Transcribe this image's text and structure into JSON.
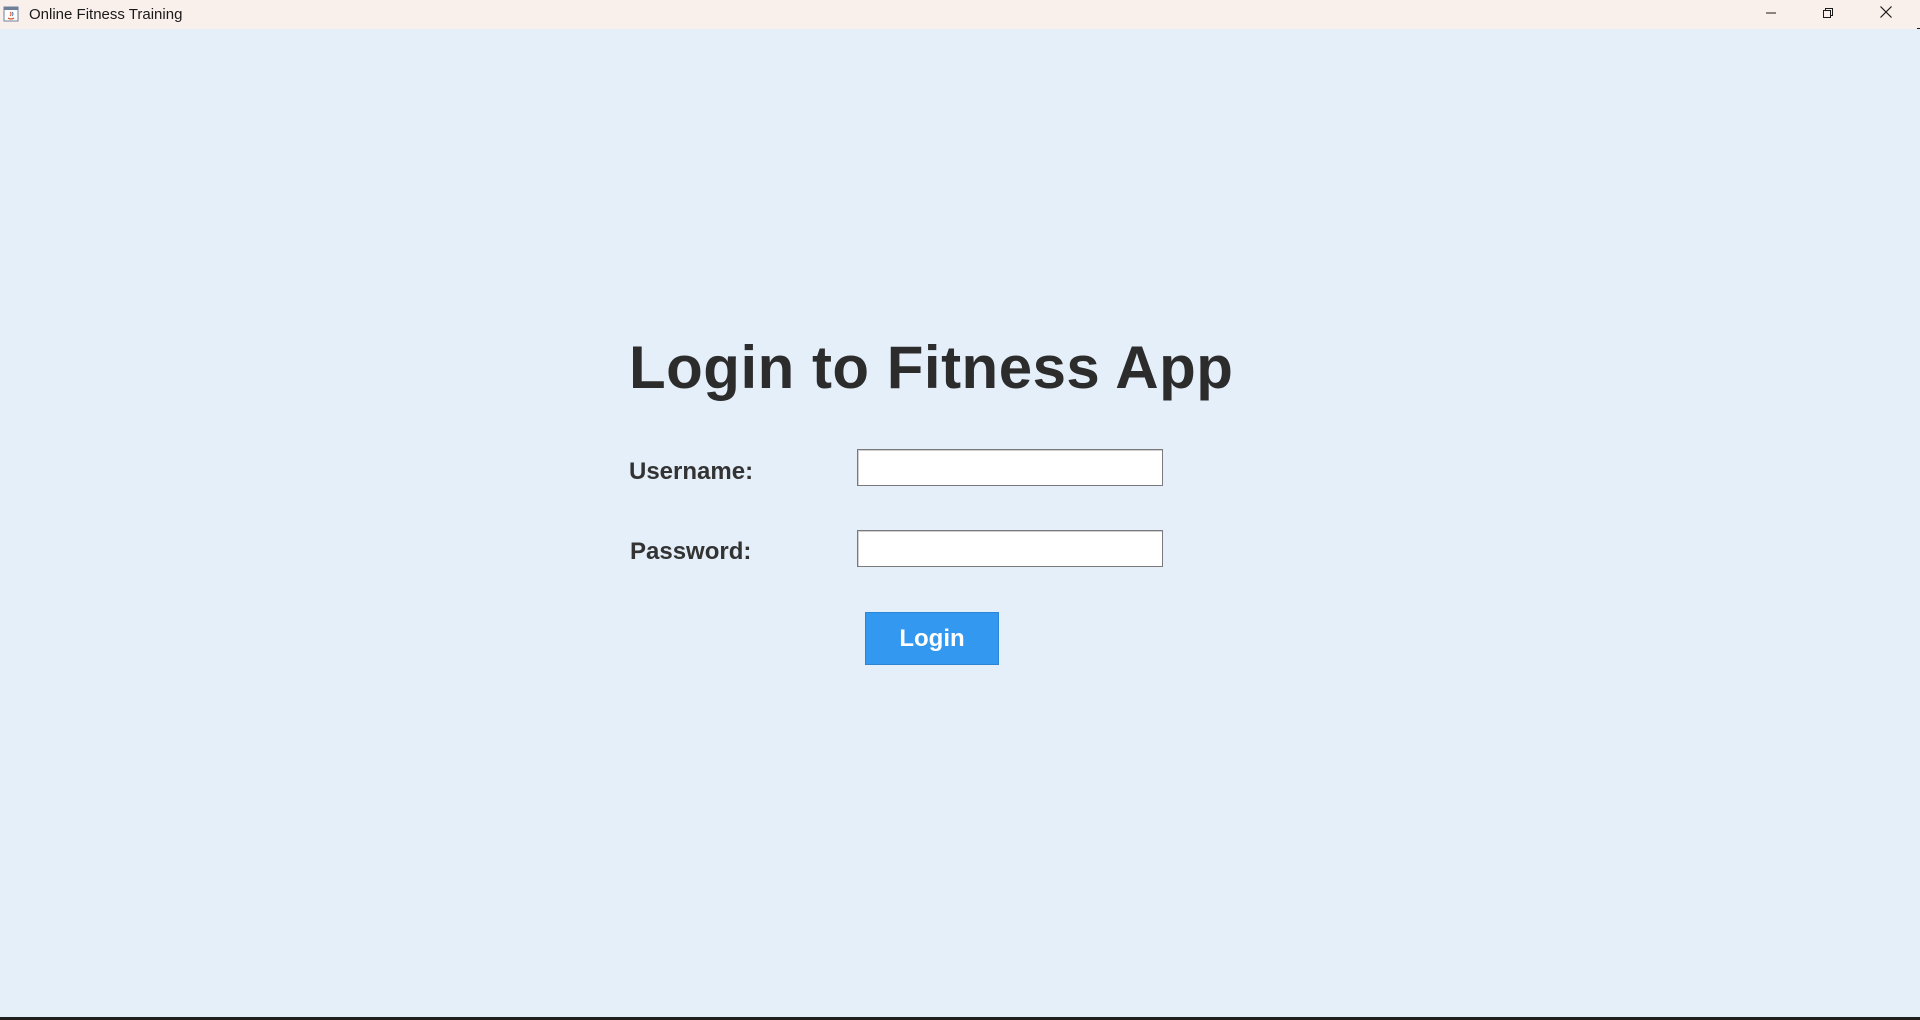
{
  "window": {
    "title": "Online Fitness Training",
    "icons": {
      "app": "java-app-icon",
      "minimize": "minimize-icon",
      "maximize": "restore-icon",
      "close": "close-icon"
    }
  },
  "login": {
    "heading": "Login to Fitness App",
    "username_label": "Username:",
    "password_label": "Password:",
    "username_value": "",
    "password_value": "",
    "button_label": "Login"
  },
  "colors": {
    "background": "#e4eff9",
    "titlebar": "#f9f0ec",
    "button": "#3399f0",
    "text": "#2c2c2c"
  }
}
